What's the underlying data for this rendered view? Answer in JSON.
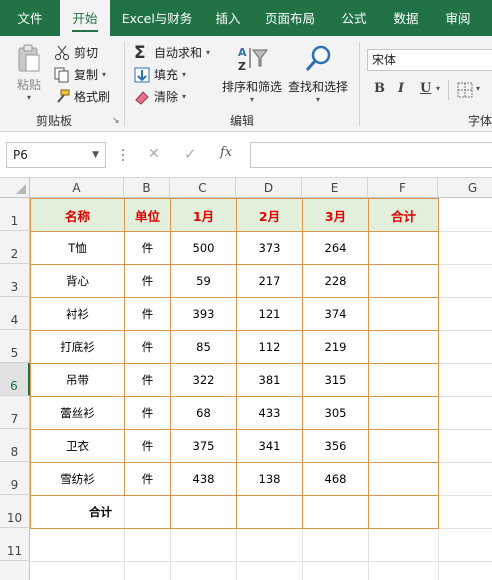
{
  "ribbon_tabs": [
    "文件",
    "开始",
    "Excel与财务",
    "插入",
    "页面布局",
    "公式",
    "数据",
    "审阅"
  ],
  "active_tab": "开始",
  "clipboard": {
    "paste": "粘贴",
    "cut": "剪切",
    "copy": "复制",
    "format_painter": "格式刷",
    "group_label": "剪贴板"
  },
  "editing": {
    "autosum": "自动求和",
    "fill": "填充",
    "clear": "清除",
    "sort_filter": "排序和筛选",
    "find_select": "查找和选择",
    "group_label": "编辑"
  },
  "font": {
    "name": "宋体",
    "bold": "B",
    "italic": "I",
    "underline": "U",
    "group_label": "字体"
  },
  "formula_bar": {
    "name_box": "P6",
    "cancel": "✕",
    "enter": "✓",
    "fx": "fx",
    "formula": ""
  },
  "columns": [
    "A",
    "B",
    "C",
    "D",
    "E",
    "F",
    "G"
  ],
  "rows": [
    "1",
    "2",
    "3",
    "4",
    "5",
    "6",
    "7",
    "8",
    "9",
    "10",
    "11"
  ],
  "selected_row": "6",
  "table": {
    "headers": [
      "名称",
      "单位",
      "1月",
      "2月",
      "3月",
      "合计"
    ],
    "data": [
      [
        "T恤",
        "件",
        "500",
        "373",
        "264",
        ""
      ],
      [
        "背心",
        "件",
        "59",
        "217",
        "228",
        ""
      ],
      [
        "衬衫",
        "件",
        "393",
        "121",
        "374",
        ""
      ],
      [
        "打底衫",
        "件",
        "85",
        "112",
        "219",
        ""
      ],
      [
        "吊带",
        "件",
        "322",
        "381",
        "315",
        ""
      ],
      [
        "蕾丝衫",
        "件",
        "68",
        "433",
        "305",
        ""
      ],
      [
        "卫衣",
        "件",
        "375",
        "341",
        "356",
        ""
      ],
      [
        "雪纺衫",
        "件",
        "438",
        "138",
        "468",
        ""
      ]
    ],
    "total_label": "合计"
  },
  "colors": {
    "accent": "#217346",
    "header_fill": "#e2efda",
    "header_text": "#e00000",
    "table_border": "#d9954c"
  }
}
